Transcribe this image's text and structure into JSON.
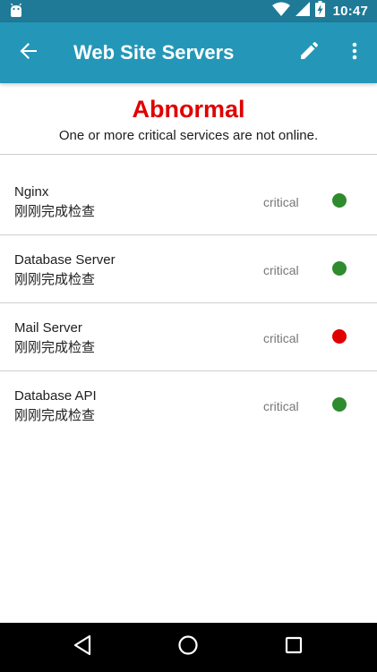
{
  "status_bar": {
    "time": "10:47",
    "left_icon": "android-icon",
    "right_icons": [
      "wifi-icon",
      "signal-icon",
      "battery-charging-icon"
    ]
  },
  "app_bar": {
    "title": "Web Site Servers",
    "back_icon": "arrow-back-icon",
    "edit_icon": "edit-pencil-icon",
    "more_icon": "more-vert-icon"
  },
  "summary": {
    "status": "Abnormal",
    "message": "One or more critical services are not online.",
    "status_color": "#e00000"
  },
  "services": [
    {
      "name": "Nginx",
      "subtext": "刚刚完成检查",
      "level": "critical",
      "status_color": "#2e8b2e"
    },
    {
      "name": "Database Server",
      "subtext": "刚刚完成检查",
      "level": "critical",
      "status_color": "#2e8b2e"
    },
    {
      "name": "Mail Server",
      "subtext": "刚刚完成检查",
      "level": "critical",
      "status_color": "#e00000"
    },
    {
      "name": "Database API",
      "subtext": "刚刚完成检查",
      "level": "critical",
      "status_color": "#2e8b2e"
    }
  ],
  "nav_bar": {
    "back_icon": "nav-back-icon",
    "home_icon": "nav-home-icon",
    "recent_icon": "nav-recent-apps-icon"
  },
  "colors": {
    "app_bar": "#2497b8",
    "status_bar": "#1e7a97",
    "online": "#2e8b2e",
    "offline": "#e00000"
  }
}
